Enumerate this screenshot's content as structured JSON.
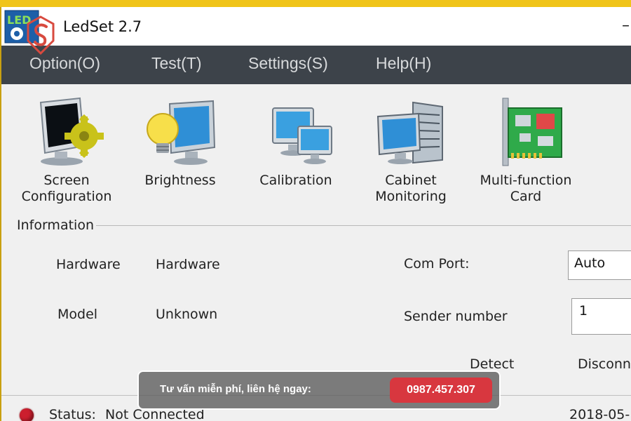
{
  "window": {
    "title": "LedSet 2.7",
    "minimize_glyph": "–"
  },
  "menu": {
    "items": [
      "Option(O)",
      "Test(T)",
      "Settings(S)",
      "Help(H)"
    ]
  },
  "toolbar": {
    "items": [
      {
        "label": "Screen\nConfiguration",
        "icon": "screen-config-icon"
      },
      {
        "label": "Brightness",
        "icon": "brightness-icon"
      },
      {
        "label": "Calibration",
        "icon": "calibration-icon"
      },
      {
        "label": "Cabinet\nMonitoring",
        "icon": "cabinet-monitoring-icon"
      },
      {
        "label": "Multi-function\nCard",
        "icon": "multifunction-card-icon"
      }
    ]
  },
  "information": {
    "group_title": "Information",
    "hardware_label": "Hardware",
    "hardware_value": "Hardware",
    "model_label": "Model",
    "model_value": "Unknown",
    "com_port_label": "Com Port:",
    "com_port_value": "Auto",
    "sender_number_label": "Sender number",
    "sender_number_value": "1",
    "detect_label": "Detect",
    "disconnect_label": "Disconne"
  },
  "status": {
    "label": "Status:",
    "value": "Not Connected",
    "date": "2018-05-",
    "indicator_color": "#cc1f2e"
  },
  "promo": {
    "text": "Tư vấn miễn phí, liên hệ ngay:",
    "phone": "0987.457.307"
  },
  "colors": {
    "menubar": "#3d434a",
    "frame": "#f0c419",
    "accent_red": "#d8373f"
  }
}
